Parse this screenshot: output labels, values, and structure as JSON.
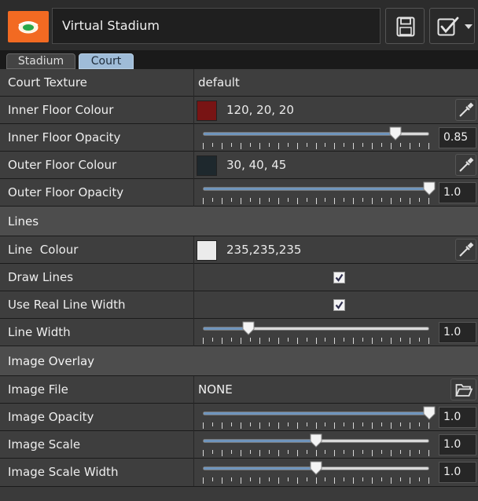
{
  "header": {
    "app_icon": "stadium-icon",
    "title": "Virtual Stadium",
    "save_icon": "floppy-disk-icon",
    "check_icon": "checkbox-icon"
  },
  "tabs": [
    {
      "label": "Stadium",
      "active": false
    },
    {
      "label": "Court",
      "active": true
    }
  ],
  "court": {
    "court_texture": {
      "label": "Court Texture",
      "value": "default"
    },
    "inner_floor_colour": {
      "label": "Inner Floor Colour",
      "value": "120, 20, 20",
      "color": "#781414"
    },
    "inner_floor_opacity": {
      "label": "Inner Floor Opacity",
      "value": "0.85",
      "level": 0.85
    },
    "outer_floor_colour": {
      "label": "Outer Floor Colour",
      "value": "30, 40, 45",
      "color": "#1e282d"
    },
    "outer_floor_opacity": {
      "label": "Outer Floor Opacity",
      "value": "1.0",
      "level": 1.0
    }
  },
  "lines": {
    "section_title": "Lines",
    "line_colour": {
      "label": "Line  Colour",
      "value": "235,235,235",
      "color": "#ebebeb"
    },
    "draw_lines": {
      "label": "Draw Lines",
      "checked": true
    },
    "use_real_line_width": {
      "label": "Use Real Line Width",
      "checked": true
    },
    "line_width": {
      "label": "Line Width",
      "value": "1.0",
      "level": 0.2
    }
  },
  "image_overlay": {
    "section_title": "Image Overlay",
    "image_file": {
      "label": "Image File",
      "value": "NONE"
    },
    "image_opacity": {
      "label": "Image Opacity",
      "value": "1.0",
      "level": 1.0
    },
    "image_scale": {
      "label": "Image Scale",
      "value": "1.0",
      "level": 0.5
    },
    "image_scale_width": {
      "label": "Image Scale Width",
      "value": "1.0",
      "level": 0.5
    }
  },
  "colors": {
    "accent": "#f26a22",
    "slider_fill": "#6f95bd",
    "active_tab": "#9fbcd8"
  }
}
